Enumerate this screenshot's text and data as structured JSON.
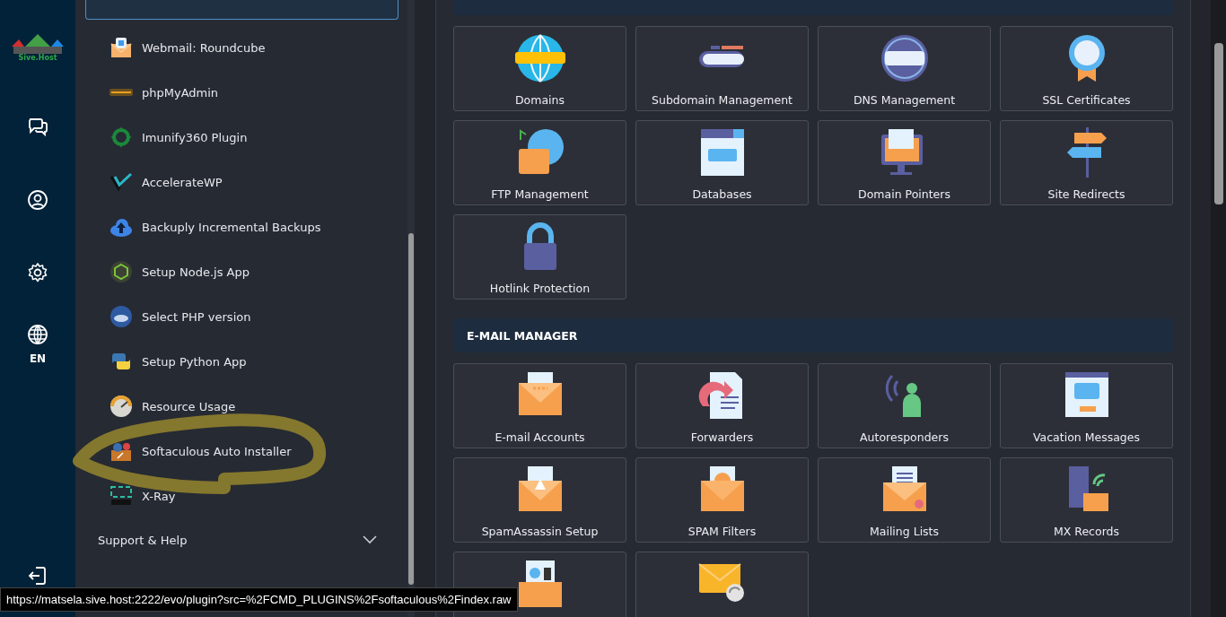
{
  "logo_text": "Sive.Host",
  "rail": {
    "language": "EN"
  },
  "menu": {
    "items": [
      {
        "label": "Webmail: Roundcube"
      },
      {
        "label": "phpMyAdmin"
      },
      {
        "label": "Imunify360 Plugin"
      },
      {
        "label": "AccelerateWP"
      },
      {
        "label": "Backuply Incremental Backups"
      },
      {
        "label": "Setup Node.js App"
      },
      {
        "label": "Select PHP version"
      },
      {
        "label": "Setup Python App"
      },
      {
        "label": "Resource Usage"
      },
      {
        "label": "Softaculous Auto Installer"
      },
      {
        "label": "X-Ray"
      }
    ]
  },
  "support": {
    "label": "Support & Help",
    "expanded": false
  },
  "sections": [
    {
      "tiles": [
        {
          "label": "Domains"
        },
        {
          "label": "Subdomain Management"
        },
        {
          "label": "DNS Management"
        },
        {
          "label": "SSL Certificates"
        },
        {
          "label": "FTP Management"
        },
        {
          "label": "Databases"
        },
        {
          "label": "Domain Pointers"
        },
        {
          "label": "Site Redirects"
        },
        {
          "label": "Hotlink Protection"
        }
      ]
    },
    {
      "title": "E-MAIL MANAGER",
      "tiles": [
        {
          "label": "E-mail Accounts"
        },
        {
          "label": "Forwarders"
        },
        {
          "label": "Autoresponders"
        },
        {
          "label": "Vacation Messages"
        },
        {
          "label": "SpamAssassin Setup"
        },
        {
          "label": "SPAM Filters"
        },
        {
          "label": "Mailing Lists"
        },
        {
          "label": "MX Records"
        },
        {
          "kind": "icon_only"
        },
        {
          "kind": "icon_only"
        }
      ]
    }
  ],
  "status_url": "https://matsela.sive.host:2222/evo/plugin?src=%2FCMD_PLUGINS%2Fsoftaculous%2Findex.raw"
}
